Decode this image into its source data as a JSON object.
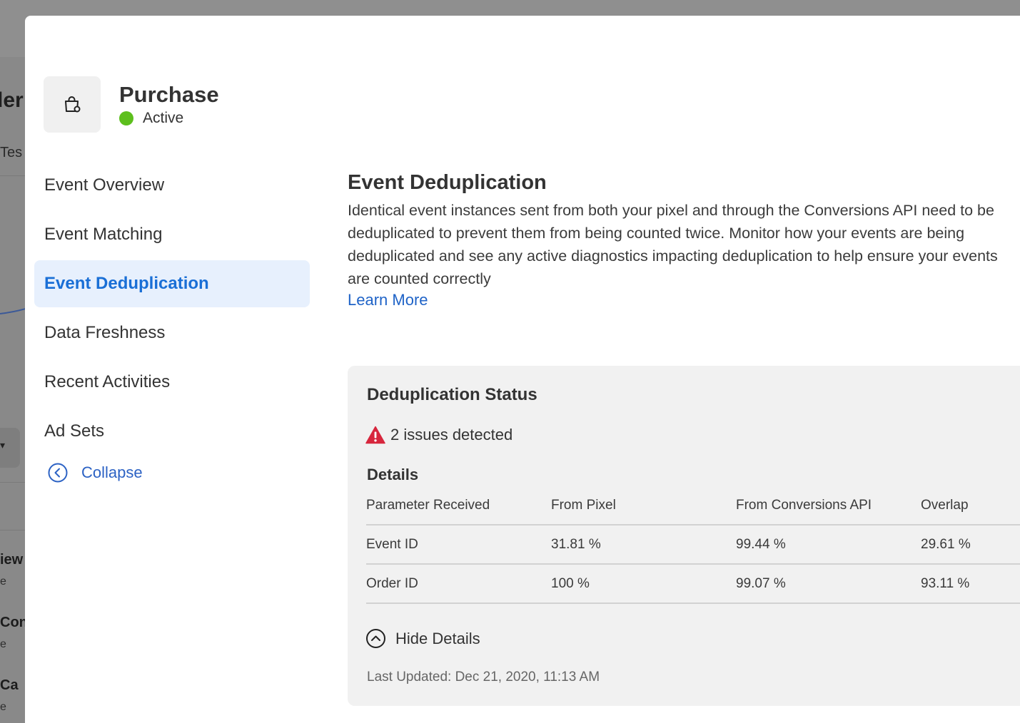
{
  "background": {
    "title_fragment": "der",
    "sub_fragment": "Tes",
    "rows": [
      {
        "title": "iew",
        "sub": "e"
      },
      {
        "title": "Cont",
        "sub": "e"
      },
      {
        "title": "Ca",
        "sub": "e"
      }
    ]
  },
  "event": {
    "name": "Purchase",
    "status": "Active",
    "icon": "shopping-bag-icon",
    "status_color": "#5dbf1d"
  },
  "nav": {
    "items": [
      {
        "label": "Event Overview",
        "active": false
      },
      {
        "label": "Event Matching",
        "active": false
      },
      {
        "label": "Event Deduplication",
        "active": true
      },
      {
        "label": "Data Freshness",
        "active": false
      },
      {
        "label": "Recent Activities",
        "active": false
      },
      {
        "label": "Ad Sets",
        "active": false
      }
    ],
    "collapse_label": "Collapse"
  },
  "section": {
    "title": "Event Deduplication",
    "description": "Identical event instances sent from both your pixel and through the Conversions API need to be deduplicated to prevent them from being counted twice. Monitor how your events are being deduplicated and see any active diagnostics impacting deduplication to help ensure your events are counted correctly",
    "learn_more": "Learn More"
  },
  "status_card": {
    "title": "Deduplication Status",
    "issues": "2 issues detected",
    "details_label": "Details",
    "table": {
      "headers": [
        "Parameter Received",
        "From Pixel",
        "From Conversions API",
        "Overlap"
      ],
      "rows": [
        [
          "Event ID",
          "31.81 %",
          "99.44 %",
          "29.61 %"
        ],
        [
          "Order ID",
          "100 %",
          "99.07 %",
          "93.11 %"
        ]
      ]
    },
    "hide_details": "Hide Details",
    "last_updated": "Last Updated: Dec 21, 2020, 11:13 AM"
  },
  "colors": {
    "accent": "#1a6fd6",
    "active_bg": "#e7f0fd",
    "warning": "#d7263d",
    "link": "#1f63c7"
  }
}
